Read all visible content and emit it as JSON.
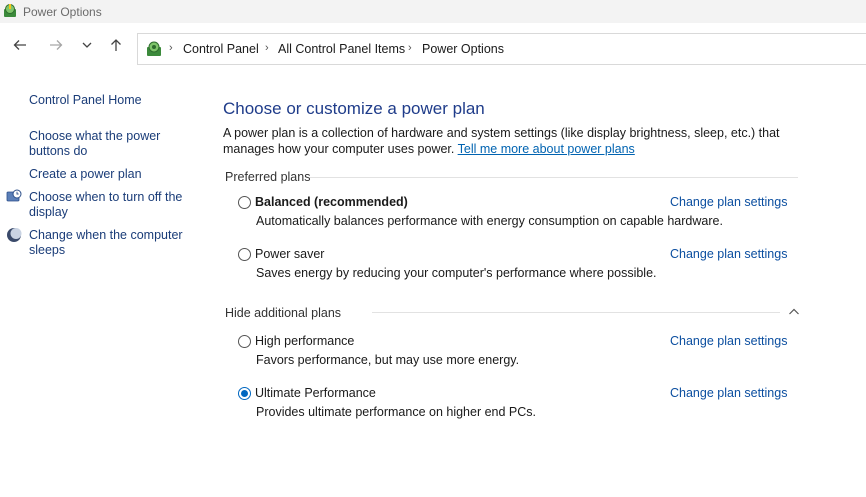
{
  "window": {
    "title": "Power Options",
    "icon": "power-options-icon"
  },
  "nav": {
    "back_icon": "back-arrow-icon",
    "forward_icon": "forward-arrow-icon",
    "recent_icon": "chevron-down-icon",
    "up_icon": "up-arrow-icon"
  },
  "breadcrumb": [
    "Control Panel",
    "All Control Panel Items",
    "Power Options"
  ],
  "sidebar": {
    "home": "Control Panel Home",
    "items": [
      {
        "label_line1": "Choose what the power",
        "label_line2": "buttons do",
        "icon": ""
      },
      {
        "label_line1": "Create a power plan",
        "label_line2": "",
        "icon": ""
      },
      {
        "label_line1": "Choose when to turn off the",
        "label_line2": "display",
        "icon": "display-timer-icon"
      },
      {
        "label_line1": "Change when the computer",
        "label_line2": "sleeps",
        "icon": "sleep-moon-icon"
      }
    ]
  },
  "main": {
    "title": "Choose or customize a power plan",
    "description": "A power plan is a collection of hardware and system settings (like display brightness, sleep, etc.) that manages how your computer uses power.",
    "learn_more": "Tell me more about power plans",
    "preferred_header": "Preferred plans",
    "additional_header": "Hide additional plans",
    "change_label": "Change plan settings",
    "plans": [
      {
        "name": "Balanced (recommended)",
        "desc": "Automatically balances performance with energy consumption on capable hardware.",
        "selected": false
      },
      {
        "name": "Power saver",
        "desc": "Saves energy by reducing your computer's performance where possible.",
        "selected": false
      },
      {
        "name": "High performance",
        "desc": "Favors performance, but may use more energy.",
        "selected": false
      },
      {
        "name": "Ultimate Performance",
        "desc": "Provides ultimate performance on higher end PCs.",
        "selected": true
      }
    ]
  },
  "colors": {
    "accent": "#0067c0",
    "link": "#0c4fa0",
    "title": "#1f3c8a"
  }
}
